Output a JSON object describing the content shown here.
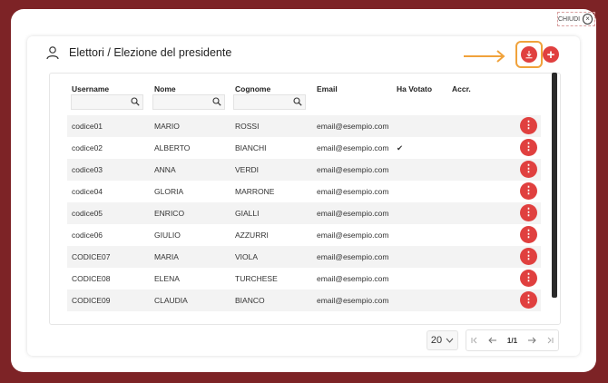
{
  "close": {
    "label": "CHIUDI",
    "icon": "close-circle-icon"
  },
  "header": {
    "title": "Elettori / Elezione del presidente",
    "icon": "user-icon"
  },
  "toolbar": {
    "download_icon": "download-icon",
    "add_icon": "plus-icon",
    "add_label": "+"
  },
  "columns": [
    "Username",
    "Nome",
    "Cognome",
    "Email",
    "Ha Votato",
    "Accr."
  ],
  "rows": [
    {
      "username": "codice01",
      "nome": "MARIO",
      "cognome": "ROSSI",
      "email": "email@esempio.com",
      "voted": ""
    },
    {
      "username": "codice02",
      "nome": "ALBERTO",
      "cognome": "BIANCHI",
      "email": "email@esempio.com",
      "voted": "✔"
    },
    {
      "username": "codice03",
      "nome": "ANNA",
      "cognome": "VERDI",
      "email": "email@esempio.com",
      "voted": ""
    },
    {
      "username": "codice04",
      "nome": "GLORIA",
      "cognome": "MARRONE",
      "email": "email@esempio.com",
      "voted": ""
    },
    {
      "username": "codice05",
      "nome": "ENRICO",
      "cognome": "GIALLI",
      "email": "email@esempio.com",
      "voted": ""
    },
    {
      "username": "codice06",
      "nome": "GIULIO",
      "cognome": "AZZURRI",
      "email": "email@esempio.com",
      "voted": ""
    },
    {
      "username": "CODICE07",
      "nome": "MARIA",
      "cognome": "VIOLA",
      "email": "email@esempio.com",
      "voted": ""
    },
    {
      "username": "CODICE08",
      "nome": "ELENA",
      "cognome": "TURCHESE",
      "email": "email@esempio.com",
      "voted": ""
    },
    {
      "username": "CODICE09",
      "nome": "CLAUDIA",
      "cognome": "BIANCO",
      "email": "email@esempio.com",
      "voted": ""
    }
  ],
  "row_menu_label": "⋮",
  "pagination": {
    "page_size": "20",
    "page": "1/1"
  },
  "colors": {
    "background": "#7d2326",
    "accent": "#e0403f",
    "highlight": "#f0a23b"
  }
}
